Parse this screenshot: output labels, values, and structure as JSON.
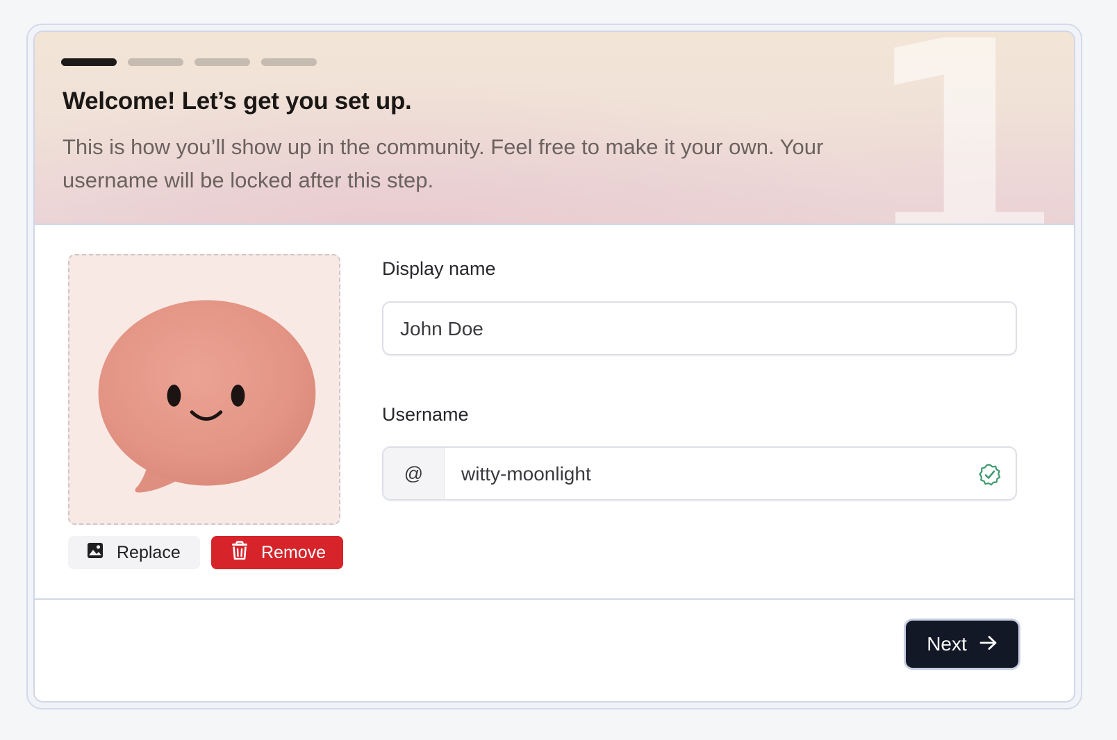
{
  "progress": {
    "total_steps": 4,
    "current_step": 1,
    "active_color": "#1c1b1a",
    "inactive_color": "#c5bbb1"
  },
  "hero": {
    "step_number": "1",
    "title": "Welcome! Let’s get you set up.",
    "subtitle": "This is how you’ll show up in the community. Feel free to make it your own. Your username will be locked after this step."
  },
  "avatar": {
    "image": "pink-speech-bubble-smiley",
    "replace_label": "Replace",
    "remove_label": "Remove",
    "replace_icon": "image-icon",
    "remove_icon": "trash-icon"
  },
  "form": {
    "display_name": {
      "label": "Display name",
      "value": "John Doe"
    },
    "username": {
      "label": "Username",
      "prefix": "@",
      "value": "witty-moonlight",
      "status_icon": "verified-check-icon",
      "status_color": "#3d9a6e"
    }
  },
  "footer": {
    "next_label": "Next",
    "next_icon": "arrow-right-icon"
  },
  "colors": {
    "danger": "#d6242a",
    "primary": "#121826",
    "success": "#3d9a6e"
  }
}
